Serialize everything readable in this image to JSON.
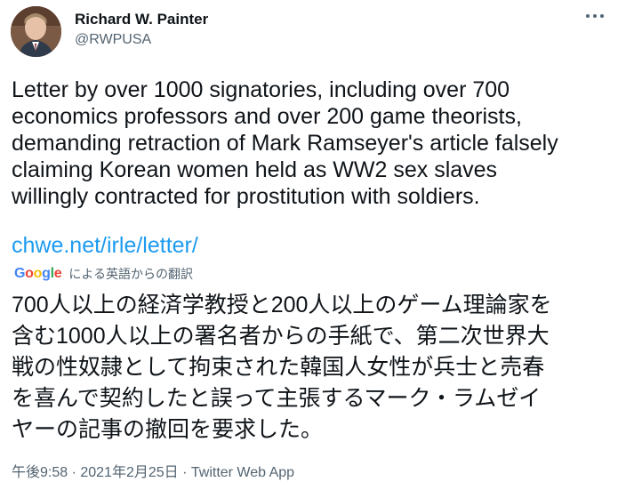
{
  "author": {
    "name": "Richard W. Painter",
    "handle": "@RWPUSA"
  },
  "tweet": {
    "text": "Letter by over 1000 signatories, including over 700\neconomics professors and over 200 game theorists,\ndemanding retraction of Mark Ramseyer's article falsely\nclaiming Korean women held as WW2 sex slaves\nwillingly contracted for prostitution with soldiers.",
    "link": "chwe.net/irle/letter/"
  },
  "translation": {
    "provider": "Google",
    "label": "による英語からの翻訳",
    "text": "700人以上の経済学教授と200人以上のゲーム理論家を\n含む1000人以上の署名者からの手紙で、第二次世界大\n戦の性奴隷として拘束された韓国人女性が兵士と売春\nを喜んで契約したと誤って主張するマーク・ラムゼイ\nヤーの記事の撤回を要求した。"
  },
  "meta": {
    "text": "午後9:58 · 2021年2月25日 · Twitter Web App"
  },
  "icons": {
    "more": "more-horizontal-icon",
    "avatar": "profile-photo"
  },
  "colors": {
    "link": "#1d9bf0",
    "secondary_text": "#536471",
    "primary_text": "#0f1419"
  }
}
